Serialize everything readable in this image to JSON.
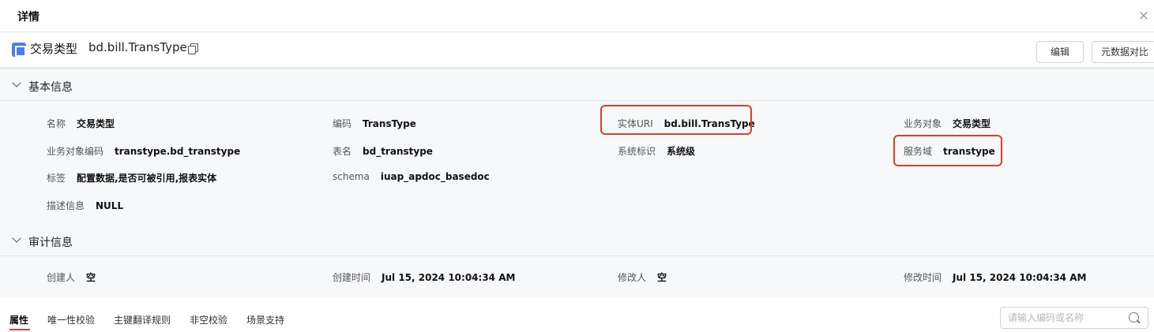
{
  "dialog": {
    "title": "详情",
    "close_glyph": "×"
  },
  "object": {
    "type_name": "交易类型",
    "uri": "bd.bill.TransType"
  },
  "buttons": {
    "edit": "编辑",
    "meta_compare": "元数据对比"
  },
  "basic": {
    "title": "基本信息",
    "fields": {
      "name": {
        "label": "名称",
        "value": "交易类型"
      },
      "code": {
        "label": "编码",
        "value": "TransType"
      },
      "entity_uri": {
        "label": "实体URI",
        "value": "bd.bill.TransType"
      },
      "biz_object": {
        "label": "业务对象",
        "value": "交易类型"
      },
      "biz_object_code": {
        "label": "业务对象编码",
        "value": "transtype.bd_transtype"
      },
      "table_name": {
        "label": "表名",
        "value": "bd_transtype"
      },
      "system_flag": {
        "label": "系统标识",
        "value": "系统级"
      },
      "service_domain": {
        "label": "服务域",
        "value": "transtype"
      },
      "tags": {
        "label": "标签",
        "value": "配置数据,是否可被引用,报表实体"
      },
      "schema": {
        "label": "schema",
        "value": "iuap_apdoc_basedoc"
      },
      "description": {
        "label": "描述信息",
        "value": "NULL"
      }
    }
  },
  "audit": {
    "title": "审计信息",
    "fields": {
      "creator": {
        "label": "创建人",
        "value": "空"
      },
      "created_at": {
        "label": "创建时间",
        "value": "Jul 15, 2024 10:04:34 AM"
      },
      "modifier": {
        "label": "修改人",
        "value": "空"
      },
      "modified_at": {
        "label": "修改时间",
        "value": "Jul 15, 2024 10:04:34 AM"
      }
    }
  },
  "tabs": [
    "属性",
    "唯一性校验",
    "主键翻译规则",
    "非空校验",
    "场景支持"
  ],
  "active_tab": "属性",
  "search": {
    "placeholder": "请输入编码或名称",
    "value": ""
  },
  "colors": {
    "highlight": "#e23a2c",
    "accent": "#4b7bec",
    "active_underline": "#e23a2c"
  }
}
